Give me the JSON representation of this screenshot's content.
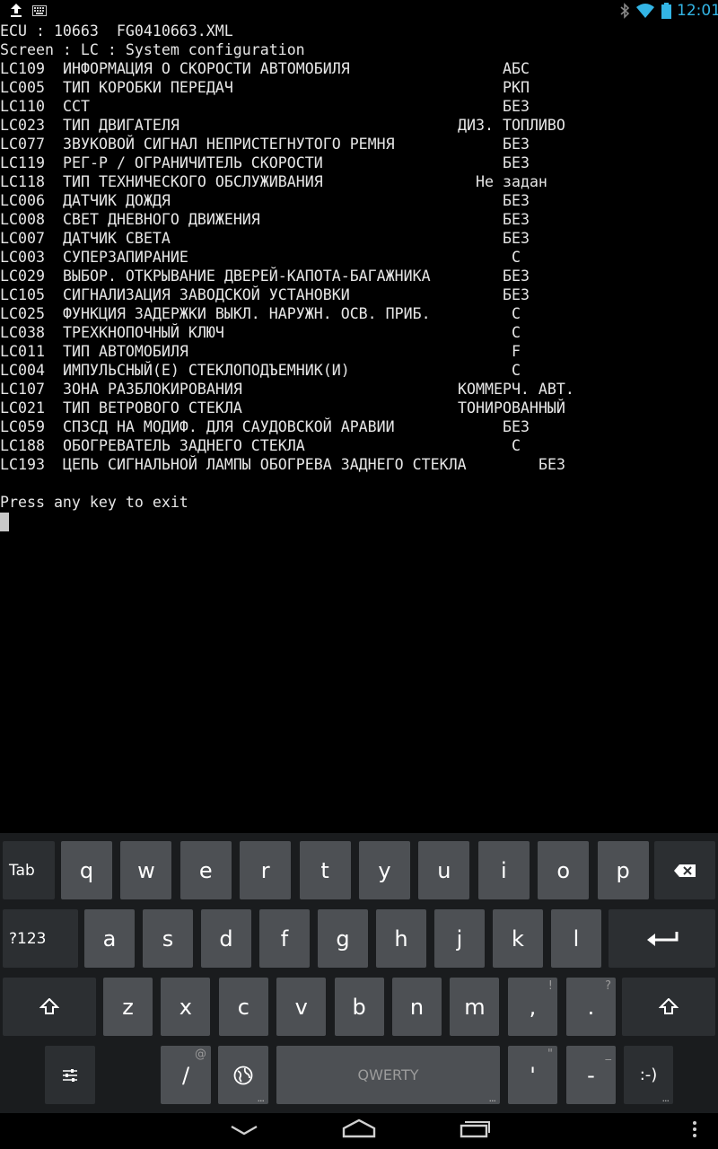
{
  "status_bar": {
    "time": "12:01",
    "icons": [
      "upload-icon",
      "keyboard-icon",
      "bluetooth-icon",
      "wifi-icon",
      "battery-icon"
    ]
  },
  "terminal": {
    "header": [
      "ECU : 10663  FG0410663.XML",
      "Screen : LC : System configuration"
    ],
    "rows": [
      {
        "code": "LC109",
        "desc": "ИНФОРМАЦИЯ О СКОРОСТИ АВТОМОБИЛЯ",
        "value": "АБС"
      },
      {
        "code": "LC005",
        "desc": "ТИП КОРОБКИ ПЕРЕДАЧ",
        "value": "РКП"
      },
      {
        "code": "LC110",
        "desc": "ССТ",
        "value": "БЕЗ"
      },
      {
        "code": "LC023",
        "desc": "ТИП ДВИГАТЕЛЯ",
        "value": "ДИЗ. ТОПЛИВО"
      },
      {
        "code": "LC077",
        "desc": "ЗВУКОВОЙ СИГНАЛ НЕПРИСТЕГНУТОГО РЕМНЯ",
        "value": "БЕЗ"
      },
      {
        "code": "LC119",
        "desc": "РЕГ-Р / ОГРАНИЧИТЕЛЬ СКОРОСТИ",
        "value": "БЕЗ"
      },
      {
        "code": "LC118",
        "desc": "ТИП ТЕХНИЧЕСКОГО ОБСЛУЖИВАНИЯ",
        "value": "Не задан"
      },
      {
        "code": "LC006",
        "desc": "ДАТЧИК ДОЖДЯ",
        "value": "БЕЗ"
      },
      {
        "code": "LC008",
        "desc": "СВЕТ ДНЕВНОГО ДВИЖЕНИЯ",
        "value": "БЕЗ"
      },
      {
        "code": "LC007",
        "desc": "ДАТЧИК СВЕТА",
        "value": "БЕЗ"
      },
      {
        "code": "LC003",
        "desc": "СУПЕРЗАПИРАНИЕ",
        "value": "С"
      },
      {
        "code": "LC029",
        "desc": "ВЫБОР. ОТКРЫВАНИЕ ДВЕРЕЙ-КАПОТА-БАГАЖНИКА",
        "value": "БЕЗ"
      },
      {
        "code": "LC105",
        "desc": "СИГНАЛИЗАЦИЯ ЗАВОДСКОЙ УСТАНОВКИ",
        "value": "БЕЗ"
      },
      {
        "code": "LC025",
        "desc": "ФУНКЦИЯ ЗАДЕРЖКИ ВЫКЛ. НАРУЖН. ОСВ. ПРИБ.",
        "value": "С"
      },
      {
        "code": "LC038",
        "desc": "ТРЕХКНОПОЧНЫЙ КЛЮЧ",
        "value": "С"
      },
      {
        "code": "LC011",
        "desc": "ТИП АВТОМОБИЛЯ",
        "value": "F"
      },
      {
        "code": "LC004",
        "desc": "ИМПУЛЬСНЫЙ(Е) СТЕКЛОПОДЪЕМНИК(И)",
        "value": "С"
      },
      {
        "code": "LC107",
        "desc": "ЗОНА РАЗБЛОКИРОВАНИЯ",
        "value": "КОММЕРЧ. АВТ."
      },
      {
        "code": "LC021",
        "desc": "ТИП ВЕТРОВОГО СТЕКЛА",
        "value": "ТОНИРОВАННЫЙ"
      },
      {
        "code": "LC059",
        "desc": "СПЗСД НА МОДИФ. ДЛЯ САУДОВСКОЙ АРАВИИ",
        "value": "БЕЗ"
      },
      {
        "code": "LC188",
        "desc": "ОБОГРЕВАТЕЛЬ ЗАДНЕГО СТЕКЛА",
        "value": "С"
      },
      {
        "code": "LC193",
        "desc": "ЦЕПЬ СИГНАЛЬНОЙ ЛАМПЫ ОБОГРЕВА ЗАДНЕГО СТЕКЛА",
        "value": "БЕЗ"
      }
    ],
    "footer": "Press any key to exit"
  },
  "keyboard": {
    "row1": {
      "tab": "Tab",
      "letters": [
        "q",
        "w",
        "e",
        "r",
        "t",
        "y",
        "u",
        "i",
        "o",
        "p"
      ]
    },
    "row2": {
      "symbols": "?123",
      "letters": [
        "a",
        "s",
        "d",
        "f",
        "g",
        "h",
        "j",
        "k",
        "l"
      ]
    },
    "row3": {
      "letters": [
        "z",
        "x",
        "c",
        "v",
        "b",
        "n",
        "m"
      ],
      "comma": ",",
      "comma_hint": "!",
      "period": ".",
      "period_hint": "?"
    },
    "row4": {
      "slash": "/",
      "slash_hint": "@",
      "space": "QWERTY",
      "apostrophe": "'",
      "apostrophe_hint": "\"",
      "dash": "-",
      "dash_hint": "_",
      "smiley": ":-)"
    }
  }
}
